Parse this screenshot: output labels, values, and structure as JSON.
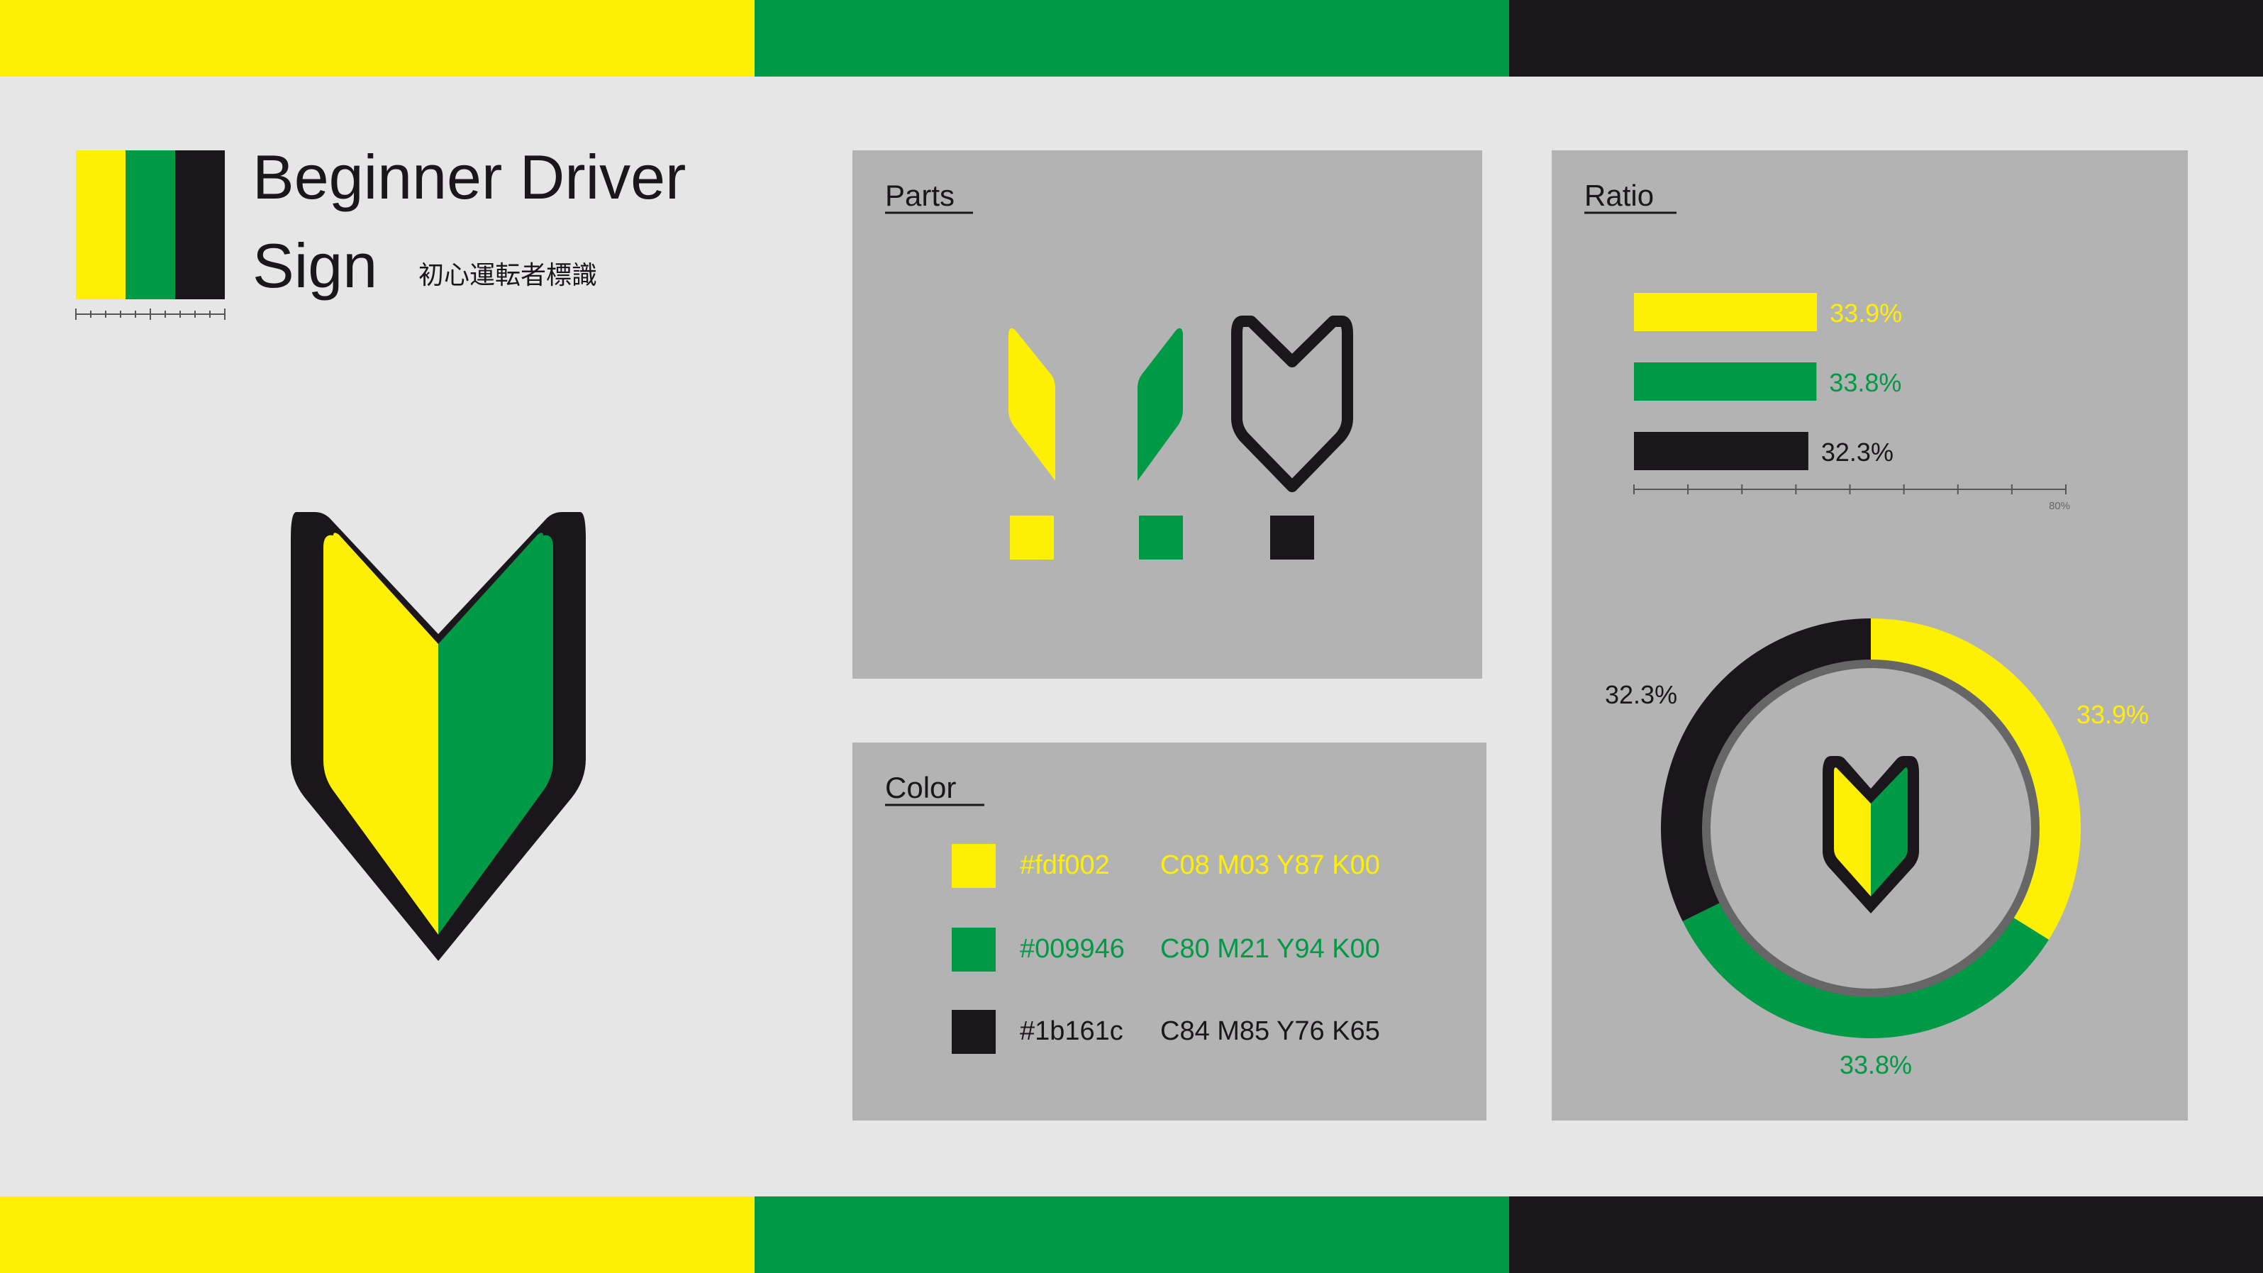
{
  "colors": {
    "yellow": "#fdf002",
    "green": "#009946",
    "black": "#1b161c",
    "panel": "#b3b3b3",
    "background": "#e6e6e6",
    "ring": "#666666"
  },
  "title": {
    "line1": "Beginner Driver",
    "line2": "Sign",
    "japanese": "初心運転者標識"
  },
  "panels": {
    "parts": {
      "heading": "Parts"
    },
    "color": {
      "heading": "Color",
      "swatches": [
        {
          "hex": "#fdf002",
          "cmyk": "C08 M03 Y87 K00"
        },
        {
          "hex": "#009946",
          "cmyk": "C80 M21 Y94 K00"
        },
        {
          "hex": "#1b161c",
          "cmyk": "C84 M85 Y76 K65"
        }
      ]
    },
    "ratio": {
      "heading": "Ratio"
    }
  },
  "chart_data": [
    {
      "type": "bar",
      "orientation": "horizontal",
      "values": [
        33.9,
        33.8,
        32.3
      ],
      "value_labels": [
        "33.9%",
        "33.8%",
        "32.3%"
      ],
      "colors": [
        "#fdf002",
        "#009946",
        "#1b161c"
      ],
      "xlim": [
        0,
        80
      ],
      "axis_end_label": "80%"
    },
    {
      "type": "pie",
      "style": "donut",
      "values": [
        33.9,
        33.8,
        32.3
      ],
      "value_labels": [
        "33.9%",
        "33.8%",
        "32.3%"
      ],
      "colors": [
        "#fdf002",
        "#009946",
        "#1b161c"
      ],
      "start": "top",
      "direction": "clockwise"
    }
  ]
}
